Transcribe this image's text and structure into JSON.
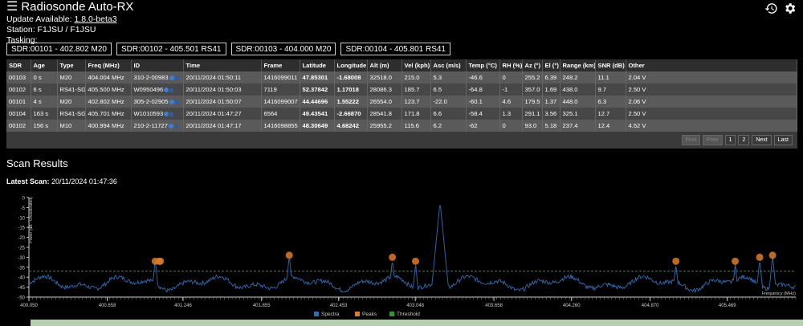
{
  "header": {
    "menu_icon": "hamburger-icon",
    "title": "Radiosonde Auto-RX",
    "update_label": "Update Available: ",
    "update_version": "1.8.0-beta3",
    "station": "Station: F1JSU / F1JSU",
    "tasking_label": "Tasking:",
    "icons": {
      "history": "history-icon",
      "settings": "gear-icon"
    }
  },
  "tasking": [
    "SDR:00101 - 402.802 M20",
    "SDR:00102 - 405.501 RS41",
    "SDR:00103 - 404.000 M20",
    "SDR:00104 - 405.801 RS41"
  ],
  "table": {
    "headers": [
      "SDR",
      "Age",
      "Type",
      "Freq (MHz)",
      "ID",
      "Time",
      "Frame",
      "Latitude",
      "Longitude",
      "Alt (m)",
      "Vel (kph)",
      "Asc (m/s)",
      "Temp (°C)",
      "RH (%)",
      "Az (°)",
      "El (°)",
      "Range (km)",
      "SNR (dB)",
      "Other"
    ],
    "rows": [
      [
        "00103",
        "0 s",
        "M20",
        "404.004 MHz",
        "310-2-00983",
        "20/11/2024 01:50:11",
        "1416099011",
        "47.85301",
        "-1.68008",
        "32518.0",
        "215.0",
        "5.3",
        "-46.6",
        "0",
        "255.2",
        "6.39",
        "248.2",
        "11.1",
        "2.04 V"
      ],
      [
        "00102",
        "6 s",
        "RS41-SG",
        "405.500 MHz",
        "W0950496",
        "20/11/2024 01:50:03",
        "7119",
        "52.37842",
        "1.17018",
        "28086.3",
        "185.7",
        "6.5",
        "-64.8",
        "-1",
        "357.0",
        "1.69",
        "438.0",
        "9.7",
        "2.50 V"
      ],
      [
        "00101",
        "4 s",
        "M20",
        "402.802 MHz",
        "305-2-02905",
        "20/11/2024 01:50:07",
        "1416099007",
        "44.44696",
        "1.55222",
        "26554.0",
        "123.7",
        "-22.0",
        "-60.1",
        "4.6",
        "179.5",
        "1.37",
        "448.0",
        "6.3",
        "2.06 V"
      ],
      [
        "00104",
        "163 s",
        "RS41-SG",
        "405.701 MHz",
        "W1010593",
        "20/11/2024 01:47:27",
        "6564",
        "49.43541",
        "-2.66870",
        "28541.8",
        "171.8",
        "6.6",
        "-58.4",
        "1.3",
        "291.1",
        "3.56",
        "325.1",
        "12.7",
        "2.50 V"
      ],
      [
        "00102",
        "156 s",
        "M10",
        "400.994 MHz",
        "210-2-11727",
        "20/11/2024 01:47:17",
        "1416098855",
        "48.30649",
        "4.68242",
        "25955.2",
        "115.6",
        "6.2",
        "-62",
        "0",
        "93.0",
        "5.18",
        "237.4",
        "12.4",
        "4.52 V"
      ]
    ],
    "pager": [
      "First",
      "Prev",
      "1",
      "2",
      "Next",
      "Last"
    ]
  },
  "scan": {
    "title": "Scan Results",
    "latest_label": "Latest Scan:",
    "latest_value": " 20/11/2024 01:47:36"
  },
  "chart_data": {
    "type": "line",
    "ylabel": "Power (dB - Uncalibrated)",
    "xlabel": "Frequency (MHz)",
    "xlim": [
      400.05,
      406.0
    ],
    "ylim": [
      -50,
      0
    ],
    "x_ticks": [
      "400.050",
      "400.658",
      "401.246",
      "401.855",
      "402.453",
      "403.048",
      "403.658",
      "404.260",
      "404.870",
      "405.469"
    ],
    "y_ticks": [
      0,
      -5,
      -10,
      -15,
      -20,
      -25,
      -30,
      -35,
      -40,
      -45,
      -50
    ],
    "threshold": -37,
    "peaks": [
      {
        "x": 401.03,
        "y": -32
      },
      {
        "x": 401.06,
        "y": -32
      },
      {
        "x": 401.07,
        "y": -32
      },
      {
        "x": 402.07,
        "y": -29
      },
      {
        "x": 402.87,
        "y": -30
      },
      {
        "x": 403.05,
        "y": -32
      },
      {
        "x": 405.07,
        "y": -32
      },
      {
        "x": 405.53,
        "y": -32
      },
      {
        "x": 405.72,
        "y": -30
      },
      {
        "x": 405.82,
        "y": -29
      }
    ],
    "spectra_peaks": [
      {
        "x": 401.03,
        "y": -31
      },
      {
        "x": 402.07,
        "y": -29
      },
      {
        "x": 402.87,
        "y": -31
      },
      {
        "x": 403.05,
        "y": -33
      },
      {
        "x": 403.24,
        "y": -2
      },
      {
        "x": 405.07,
        "y": -33
      },
      {
        "x": 405.53,
        "y": -33
      },
      {
        "x": 405.72,
        "y": -31
      },
      {
        "x": 405.82,
        "y": -29
      }
    ],
    "legend": [
      "Spectra",
      "Peaks",
      "Threshold"
    ],
    "legend_position": "bottom-center",
    "colors": {
      "spectra": "#2e6db4",
      "peaks": "#e07a24",
      "threshold": "#2a9a2a"
    }
  }
}
